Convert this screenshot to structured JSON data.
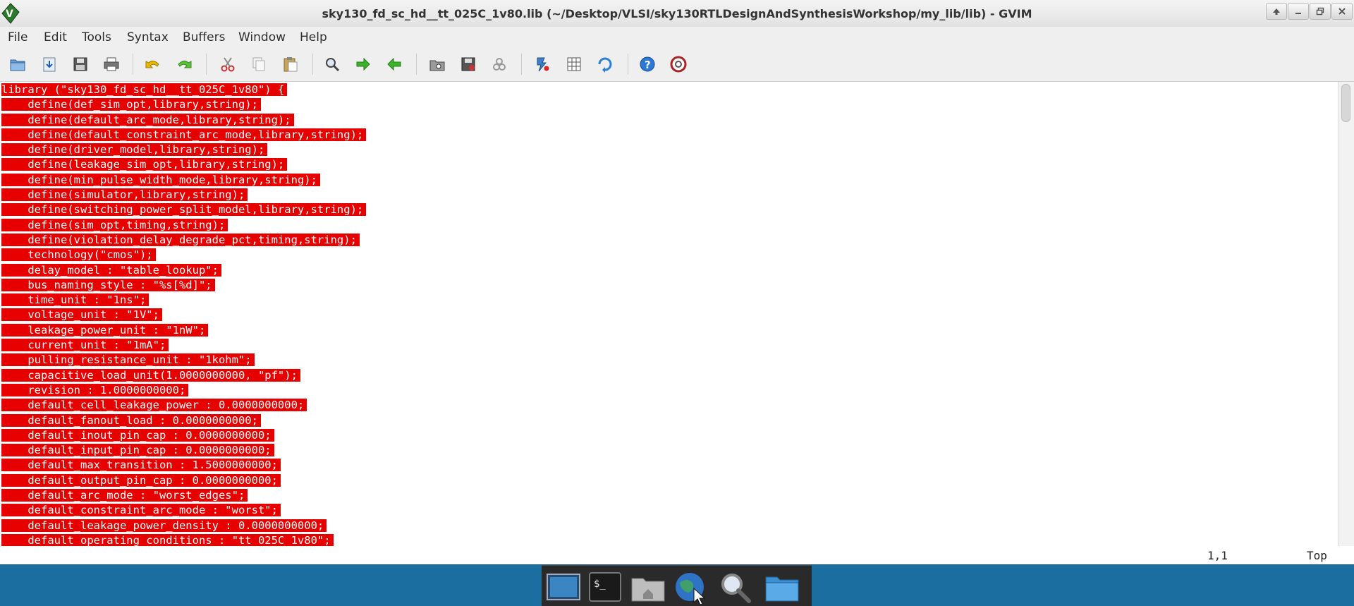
{
  "window": {
    "title": "sky130_fd_sc_hd__tt_025C_1v80.lib (~/Desktop/VLSI/sky130RTLDesignAndSynthesisWorkshop/my_lib/lib) - GVIM"
  },
  "menubar": {
    "items": [
      "File",
      "Edit",
      "Tools",
      "Syntax",
      "Buffers",
      "Window",
      "Help"
    ]
  },
  "toolbar": {
    "buttons": [
      "open-file-icon",
      "load-session-icon",
      "save-icon",
      "print-icon",
      "undo-icon",
      "redo-icon",
      "cut-icon",
      "copy-icon",
      "paste-icon",
      "find-icon",
      "find-next-icon",
      "find-previous-icon",
      "load-session-folder-icon",
      "save-session-icon",
      "run-script-icon",
      "make-icon",
      "ctags-icon",
      "jump-tag-icon",
      "help-icon",
      "find-help-icon"
    ]
  },
  "editor": {
    "selection_color": "#e60000",
    "lines": [
      "library (\"sky130_fd_sc_hd__tt_025C_1v80\") {",
      "    define(def_sim_opt,library,string);",
      "    define(default_arc_mode,library,string);",
      "    define(default_constraint_arc_mode,library,string);",
      "    define(driver_model,library,string);",
      "    define(leakage_sim_opt,library,string);",
      "    define(min_pulse_width_mode,library,string);",
      "    define(simulator,library,string);",
      "    define(switching_power_split_model,library,string);",
      "    define(sim_opt,timing,string);",
      "    define(violation_delay_degrade_pct,timing,string);",
      "    technology(\"cmos\");",
      "    delay_model : \"table_lookup\";",
      "    bus_naming_style : \"%s[%d]\";",
      "    time_unit : \"1ns\";",
      "    voltage_unit : \"1V\";",
      "    leakage_power_unit : \"1nW\";",
      "    current_unit : \"1mA\";",
      "    pulling_resistance_unit : \"1kohm\";",
      "    capacitive_load_unit(1.0000000000, \"pf\");",
      "    revision : 1.0000000000;",
      "    default_cell_leakage_power : 0.0000000000;",
      "    default_fanout_load : 0.0000000000;",
      "    default_inout_pin_cap : 0.0000000000;",
      "    default_input_pin_cap : 0.0000000000;",
      "    default_max_transition : 1.5000000000;",
      "    default_output_pin_cap : 0.0000000000;",
      "    default_arc_mode : \"worst_edges\";",
      "    default_constraint_arc_mode : \"worst\";",
      "    default_leakage_power_density : 0.0000000000;",
      "    default_operating_conditions : \"tt_025C_1v80\";"
    ]
  },
  "status": {
    "cursor_position": "1,1",
    "scroll_position": "Top"
  },
  "dock": {
    "items": [
      "show-desktop-icon",
      "terminal-icon",
      "home-folder-icon",
      "web-browser-icon",
      "search-icon",
      "files-folder-icon"
    ]
  }
}
